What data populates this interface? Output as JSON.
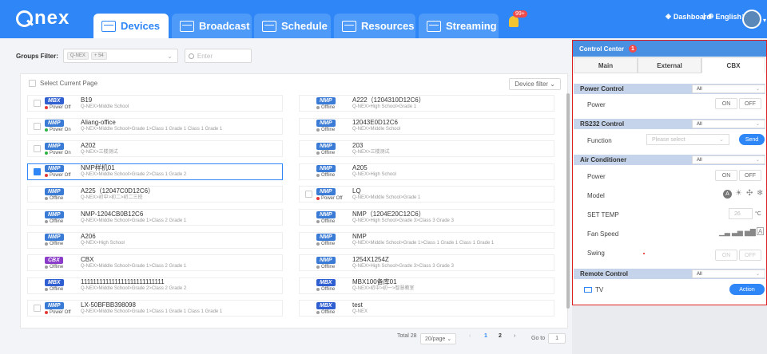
{
  "header": {
    "logo": "nex",
    "tabs": [
      {
        "label": "Devices"
      },
      {
        "label": "Broadcast"
      },
      {
        "label": "Schedule"
      },
      {
        "label": "Resources"
      },
      {
        "label": "Streaming"
      }
    ],
    "notification_count": "99+",
    "dashboard_label": "Dashboard",
    "language_label": "English"
  },
  "filter": {
    "label": "Groups Filter:",
    "tag1": "Q-NEX",
    "tag2": "+ 54",
    "search_placeholder": "Enter"
  },
  "list": {
    "select_current_page": "Select Current Page",
    "device_filter": "Device filter",
    "devices": [
      {
        "type": "MBX",
        "status": "Power Off",
        "name": "B19",
        "path": "Q-NEX>Middle School"
      },
      {
        "type": "NMP",
        "status": "Offline",
        "name": "A222（1204310D12C6）",
        "path": "Q-NEX>High School>Grade 1"
      },
      {
        "type": "NMP",
        "status": "Power On",
        "name": "Aliang-office",
        "path": "Q-NEX>Middle School>Grade 1>Class 1 Grade 1 Class 1 Grade 1"
      },
      {
        "type": "NMP",
        "status": "Offline",
        "name": "12043E0D12C6",
        "path": "Q-NEX>Middle School"
      },
      {
        "type": "NMP",
        "status": "Power On",
        "name": "A202",
        "path": "Q-NEX>三楼测试"
      },
      {
        "type": "NMP",
        "status": "Offline",
        "name": "203",
        "path": "Q-NEX>三楼测试"
      },
      {
        "type": "NMP",
        "status": "Power Off",
        "name": "NMP样机01",
        "path": "Q-NEX>Middle School>Grade 2>Class 1 Grade 2"
      },
      {
        "type": "NMP",
        "status": "Offline",
        "name": "A205",
        "path": "Q-NEX>High School"
      },
      {
        "type": "NMP",
        "status": "Offline",
        "name": "A225（12047C0D12C6）",
        "path": "Q-NEX>初中>初二>初二三班"
      },
      {
        "type": "NMP",
        "status": "Power Off",
        "name": "LQ",
        "path": "Q-NEX>Middle School>Grade 1"
      },
      {
        "type": "NMP",
        "status": "Offline",
        "name": "NMP-1204CB0B12C6",
        "path": "Q-NEX>Middle School>Grade 1>Class 2 Grade 1"
      },
      {
        "type": "NMP",
        "status": "Offline",
        "name": "NMP（1204E20C12C6）",
        "path": "Q-NEX>High School>Grade 3>Class 3 Grade 3"
      },
      {
        "type": "NMP",
        "status": "Offline",
        "name": "A206",
        "path": "Q-NEX>High School"
      },
      {
        "type": "NMP",
        "status": "Offline",
        "name": "NMP",
        "path": "Q-NEX>Middle School>Grade 1>Class 1 Grade 1 Class 1 Grade 1"
      },
      {
        "type": "CBX",
        "status": "Offline",
        "name": "CBX",
        "path": "Q-NEX>Middle School>Grade 1>Class 2 Grade 1"
      },
      {
        "type": "NMP",
        "status": "Offline",
        "name": "1254X1254Z",
        "path": "Q-NEX>High School>Grade 3>Class 3 Grade 3"
      },
      {
        "type": "MBX",
        "status": "Offline",
        "name": "111111111111111111111111111",
        "path": "Q-NEX>Middle School>Grade 2>Class 2 Grade 2"
      },
      {
        "type": "MBX",
        "status": "Offline",
        "name": "MBX100备库01",
        "path": "Q-NEX>初中>初一>智慧教室"
      },
      {
        "type": "NMP",
        "status": "Power Off",
        "name": "LX-50BFBB398098",
        "path": "Q-NEX>Middle School>Grade 1>Class 1 Grade 1 Class 1 Grade 1"
      },
      {
        "type": "MBX",
        "status": "Offline",
        "name": "test",
        "path": "Q-NEX"
      }
    ],
    "selected_index": 6
  },
  "pagination": {
    "total": "Total 28",
    "page_size": "20/page",
    "page1": "1",
    "page2": "2",
    "goto_label": "Go to",
    "goto_value": "1"
  },
  "control_center": {
    "title": "Control Center",
    "badge": "1",
    "tabs": [
      "Main",
      "External",
      "CBX"
    ],
    "power_control": {
      "title": "Power Control",
      "select": "All",
      "label": "Power",
      "on": "ON",
      "off": "OFF"
    },
    "rs232": {
      "title": "RS232 Control",
      "select": "All",
      "label": "Function",
      "placeholder": "Please select",
      "send": "Send"
    },
    "ac": {
      "title": "Air Conditioner",
      "select": "All",
      "power_label": "Power",
      "on": "ON",
      "off": "OFF",
      "model_label": "Model",
      "set_temp_label": "SET TEMP",
      "temp_value": "26",
      "temp_unit": "°C",
      "fan_label": "Fan Speed",
      "fan_auto": "A",
      "swing_label": "Swing",
      "swing_on": "ON",
      "swing_off": "OFF"
    },
    "remote": {
      "title": "Remote Control",
      "select": "All",
      "device": "TV",
      "action": "Action"
    }
  },
  "colors": {
    "primary": "#2f86f6",
    "power_on": "#2fb344",
    "power_off": "#e53935",
    "offline": "#9e9e9e"
  }
}
